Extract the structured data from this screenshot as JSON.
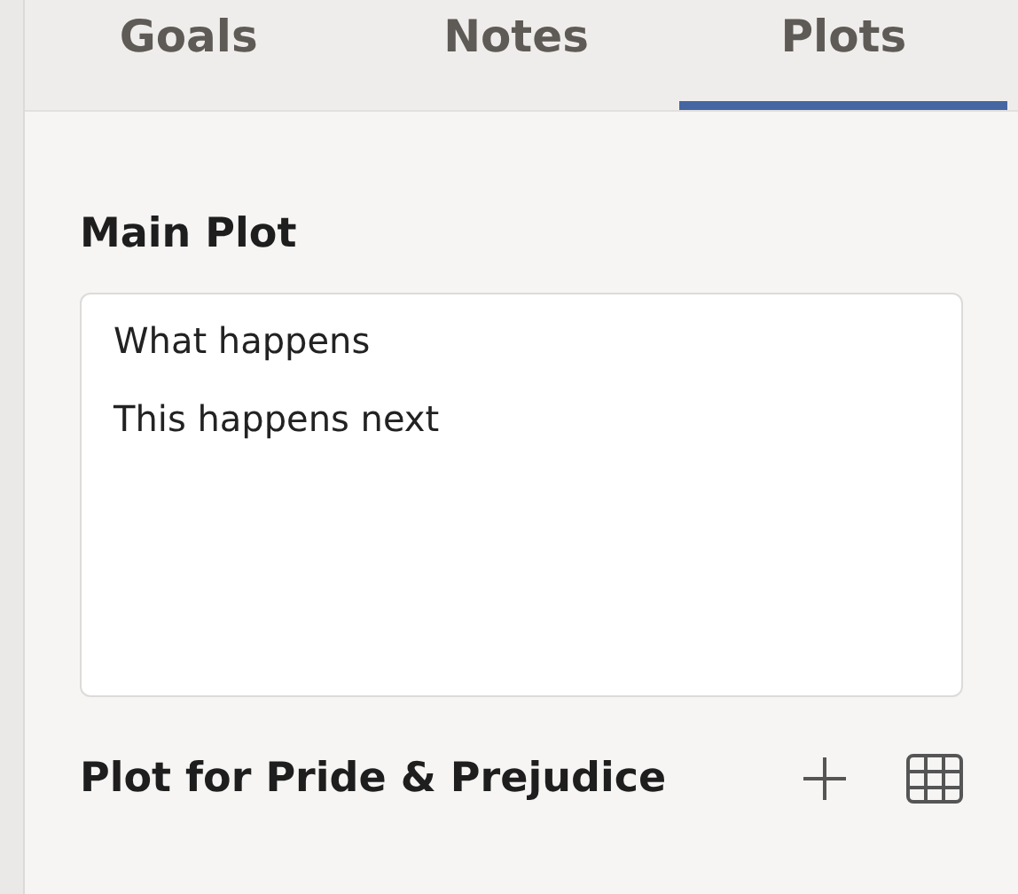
{
  "tabs": [
    {
      "label": "Goals",
      "selected": false
    },
    {
      "label": "Notes",
      "selected": false
    },
    {
      "label": "Plots",
      "selected": true
    }
  ],
  "main_plot": {
    "title": "Main Plot",
    "lines": [
      "What happens",
      "This happens next"
    ]
  },
  "next_section": {
    "title": "Plot for Pride & Prejudice"
  }
}
